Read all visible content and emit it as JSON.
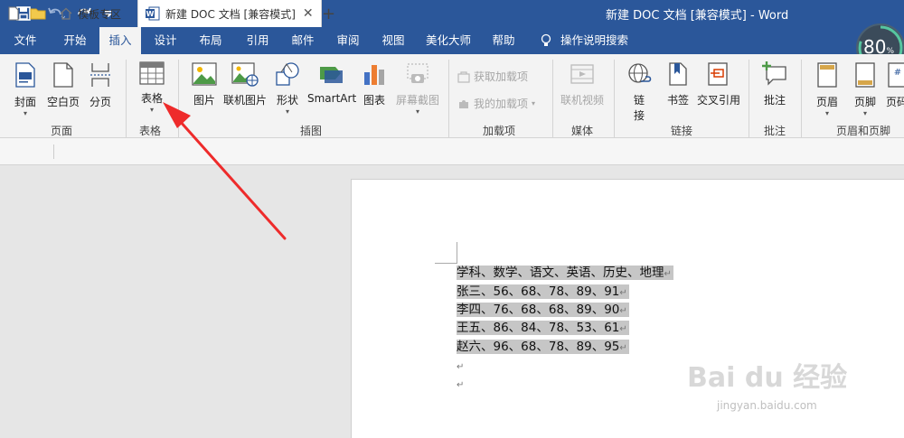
{
  "titlebar": {
    "title": "新建 DOC 文档 [兼容模式]  -  Word",
    "accent": "#2b579a"
  },
  "quick_access": {
    "icons": [
      "save-icon",
      "undo-icon",
      "redo-icon",
      "customize-icon"
    ]
  },
  "ribbon_tabs": [
    {
      "label": "文件"
    },
    {
      "label": "开始"
    },
    {
      "label": "插入",
      "active": true
    },
    {
      "label": "设计"
    },
    {
      "label": "布局"
    },
    {
      "label": "引用"
    },
    {
      "label": "邮件"
    },
    {
      "label": "审阅"
    },
    {
      "label": "视图"
    },
    {
      "label": "美化大师"
    },
    {
      "label": "帮助"
    },
    {
      "label": "操作说明搜索"
    }
  ],
  "ribbon": {
    "pages": {
      "group": "页面",
      "cover": "封面",
      "blank": "空白页",
      "break": "分页"
    },
    "tables": {
      "group": "表格",
      "table": "表格"
    },
    "illustrations": {
      "group": "插图",
      "picture": "图片",
      "online_picture": "联机图片",
      "shapes": "形状",
      "smartart": "SmartArt",
      "chart": "图表",
      "screenshot": "屏幕截图"
    },
    "addins": {
      "group": "加载项",
      "get_addins": "获取加载项",
      "my_addins": "我的加载项"
    },
    "media": {
      "group": "媒体",
      "online_video": "联机视频"
    },
    "links": {
      "group": "链接",
      "link_line1": "链",
      "link_line2": "接",
      "bookmark": "书签",
      "cross_ref": "交叉引用"
    },
    "comments": {
      "group": "批注",
      "comment": "批注"
    },
    "header_footer": {
      "group": "页眉和页脚",
      "header": "页眉",
      "footer": "页脚",
      "page_number": "页码"
    }
  },
  "doc_tabs": [
    {
      "label": "模板专区"
    },
    {
      "label": "新建 DOC 文档 [兼容模式]",
      "active": true
    }
  ],
  "progress": {
    "value": "80",
    "unit": "%"
  },
  "document": {
    "lines": [
      "学科、数学、语文、英语、历史、地理",
      "张三、56、68、78、89、91",
      "李四、76、68、68、89、90",
      "王五、86、84、78、53、61",
      "赵六、96、68、78、89、95"
    ],
    "paragraph_mark": "↵"
  },
  "watermark": {
    "brand": "Bai du 经验",
    "url": "jingyan.baidu.com"
  }
}
